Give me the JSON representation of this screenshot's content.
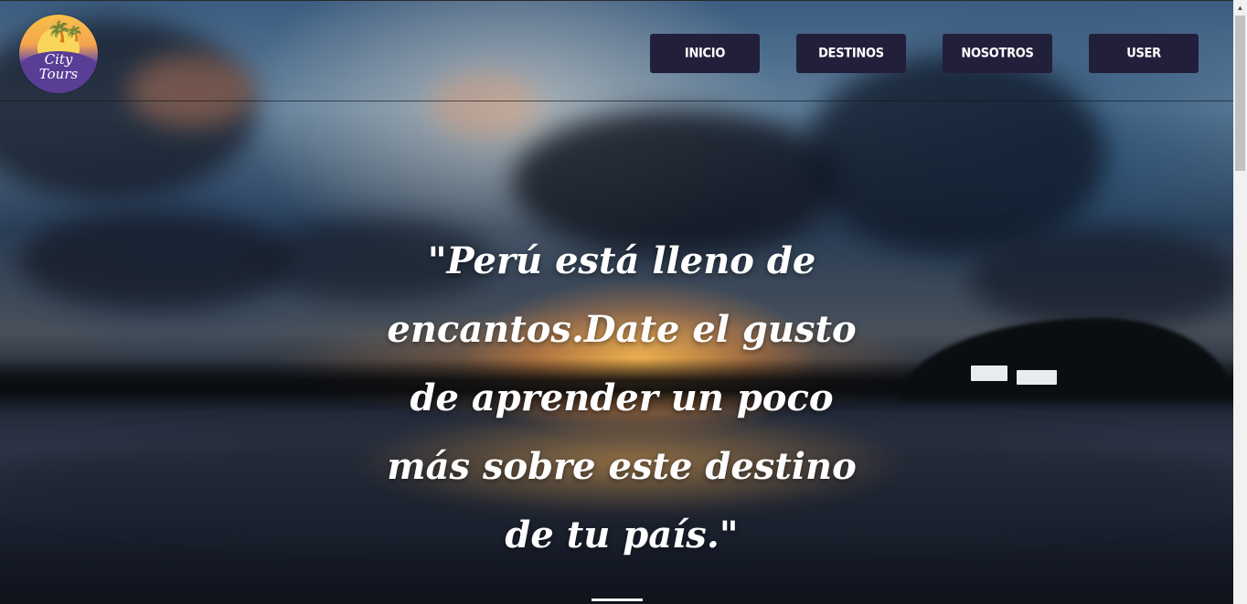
{
  "logo": {
    "line1": "City",
    "line2": "Tours",
    "icon": "palm-tree-sunset-icon"
  },
  "nav": {
    "items": [
      {
        "label": "INICIO"
      },
      {
        "label": "DESTINOS"
      },
      {
        "label": "NOSOTROS"
      },
      {
        "label": "USER"
      }
    ]
  },
  "hero": {
    "quote": "\"Perú está lleno de encantos.Date el gusto de aprender un poco más sobre este destino de tu país.\""
  },
  "colors": {
    "nav_button_bg": "#221f3b",
    "nav_button_text": "#ffffff",
    "quote_text": "#ffffff"
  }
}
